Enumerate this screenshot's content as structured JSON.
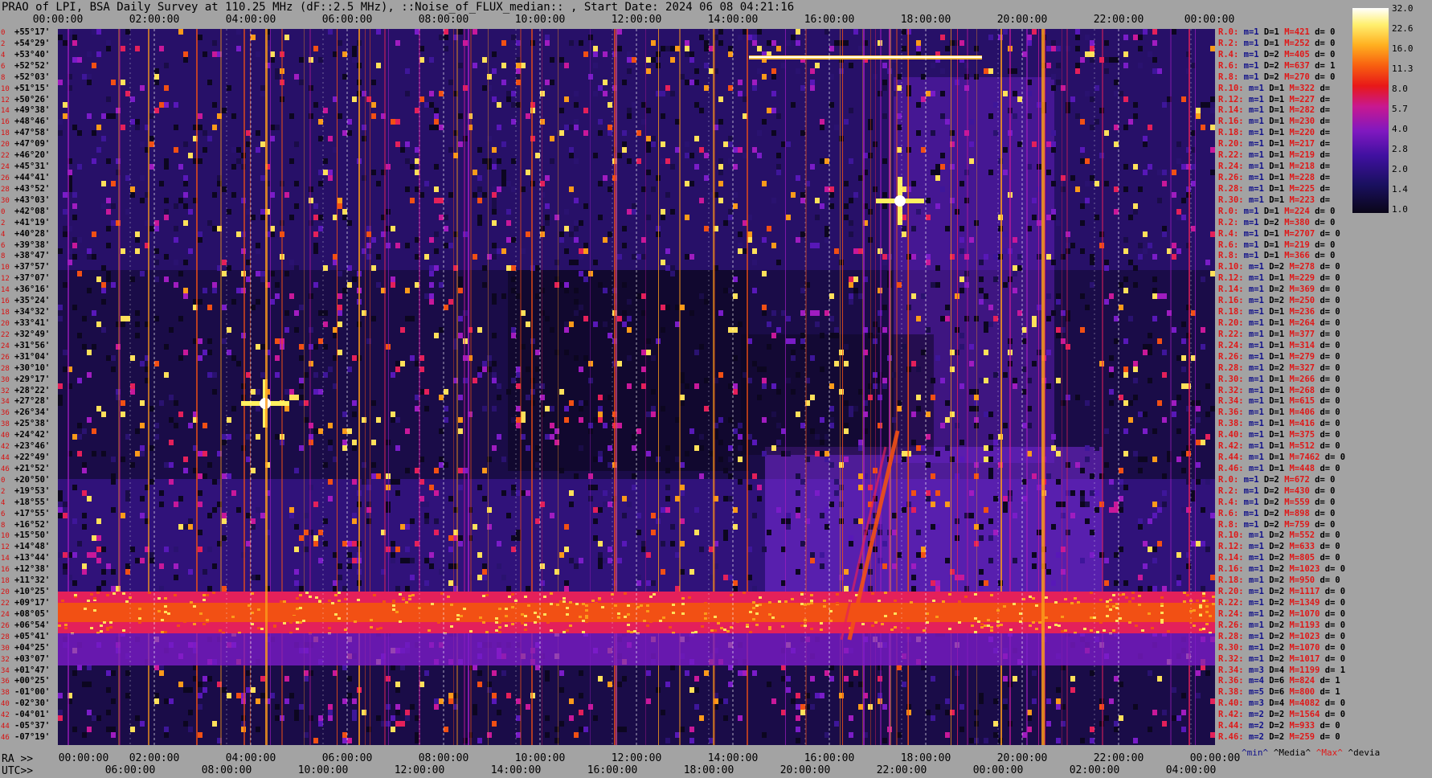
{
  "title": "PRAO of LPI, BSA Daily Survey at 110.25 MHz (dF::2.5 MHz), ::Noise_of_FLUX_median:: , Start Date: 2024 06 08 04:21:16",
  "axis_labels": {
    "ra": "RA >>",
    "utc": "UTC>>"
  },
  "footer": {
    "min": "^min^",
    "median": "^Media^",
    "max": "^Max^",
    "devia": "^devia"
  },
  "chart_data": {
    "type": "heatmap",
    "title": "PRAO of LPI, BSA Daily Survey at 110.25 MHz (dF::2.5 MHz), ::Noise_of_FLUX_median:: , Start Date: 2024 06 08 04:21:16",
    "x_top_ticks": [
      "00:00:00",
      "02:00:00",
      "04:00:00",
      "06:00:00",
      "08:00:00",
      "10:00:00",
      "12:00:00",
      "14:00:00",
      "16:00:00",
      "18:00:00",
      "20:00:00",
      "22:00:00",
      "00:00:00"
    ],
    "ra_ticks": [
      "00:00:00",
      "02:00:00",
      "04:00:00",
      "06:00:00",
      "08:00:00",
      "10:00:00",
      "12:00:00",
      "14:00:00",
      "16:00:00",
      "18:00:00",
      "20:00:00",
      "22:00:00",
      "00:00:00"
    ],
    "utc_ticks": [
      "06:00:00",
      "08:00:00",
      "10:00:00",
      "12:00:00",
      "14:00:00",
      "16:00:00",
      "18:00:00",
      "20:00:00",
      "22:00:00",
      "00:00:00",
      "02:00:00",
      "04:00:00"
    ],
    "declinations": [
      "+55°17'",
      "+54°29'",
      "+53°40'",
      "+52°52'",
      "+52°03'",
      "+51°15'",
      "+50°26'",
      "+49°38'",
      "+48°46'",
      "+47°58'",
      "+47°09'",
      "+46°20'",
      "+45°31'",
      "+44°41'",
      "+43°52'",
      "+43°03'",
      "+42°08'",
      "+41°19'",
      "+40°28'",
      "+39°38'",
      "+38°47'",
      "+37°57'",
      "+37°07'",
      "+36°16'",
      "+35°24'",
      "+34°32'",
      "+33°41'",
      "+32°49'",
      "+31°56'",
      "+31°04'",
      "+30°10'",
      "+29°17'",
      "+28°22'",
      "+27°28'",
      "+26°34'",
      "+25°38'",
      "+24°42'",
      "+23°46'",
      "+22°49'",
      "+21°52'",
      "+20°50'",
      "+19°53'",
      "+18°55'",
      "+17°55'",
      "+16°52'",
      "+15°50'",
      "+14°48'",
      "+13°44'",
      "+12°38'",
      "+11°32'",
      "+10°25'",
      "+09°17'",
      "+08°05'",
      "+06°54'",
      "+05°41'",
      "+04°25'",
      "+03°07'",
      "+01°47'",
      "+00°25'",
      "-01°00'",
      "-02°30'",
      "-04°01'",
      "-05°37'",
      "-07°19'"
    ],
    "row_indices": [
      "0",
      "2",
      "4",
      "6",
      "8",
      "10",
      "12",
      "14",
      "16",
      "18",
      "20",
      "22",
      "24",
      "26",
      "28",
      "30",
      "0",
      "2",
      "4",
      "6",
      "8",
      "10",
      "12",
      "14",
      "16",
      "18",
      "20",
      "22",
      "24",
      "26",
      "28",
      "30",
      "32",
      "34",
      "36",
      "38",
      "40",
      "42",
      "44",
      "46",
      "0",
      "2",
      "4",
      "6",
      "8",
      "10",
      "12",
      "14",
      "16",
      "18",
      "20",
      "22",
      "24",
      "26",
      "28",
      "30",
      "32",
      "34",
      "36",
      "38",
      "40",
      "42",
      "44",
      "46"
    ],
    "colorbar": {
      "values": [
        "32.0",
        "22.6",
        "16.0",
        "11.3",
        "8.0",
        "5.7",
        "4.0",
        "2.8",
        "2.0",
        "1.4",
        "1.0"
      ],
      "min": 1.0,
      "max": 32.0,
      "scale": "log"
    },
    "row_stats": [
      {
        "r": "R.0:",
        "m": "m=1",
        "d": "D=1",
        "h": "M=421",
        "v": "d= 0"
      },
      {
        "r": "R.2:",
        "m": "m=1",
        "d": "D=1",
        "h": "M=252",
        "v": "d= 0"
      },
      {
        "r": "R.4:",
        "m": "m=1",
        "d": "D=2",
        "h": "M=405",
        "v": "d= 0"
      },
      {
        "r": "R.6:",
        "m": "m=1",
        "d": "D=2",
        "h": "M=637",
        "v": "d= 1"
      },
      {
        "r": "R.8:",
        "m": "m=1",
        "d": "D=2",
        "h": "M=270",
        "v": "d= 0"
      },
      {
        "r": "R.10:",
        "m": "m=1",
        "d": "D=1",
        "h": "M=322",
        "v": "d="
      },
      {
        "r": "R.12:",
        "m": "m=1",
        "d": "D=1",
        "h": "M=227",
        "v": "d="
      },
      {
        "r": "R.14:",
        "m": "m=1",
        "d": "D=1",
        "h": "M=282",
        "v": "d="
      },
      {
        "r": "R.16:",
        "m": "m=1",
        "d": "D=1",
        "h": "M=230",
        "v": "d="
      },
      {
        "r": "R.18:",
        "m": "m=1",
        "d": "D=1",
        "h": "M=220",
        "v": "d="
      },
      {
        "r": "R.20:",
        "m": "m=1",
        "d": "D=1",
        "h": "M=217",
        "v": "d="
      },
      {
        "r": "R.22:",
        "m": "m=1",
        "d": "D=1",
        "h": "M=219",
        "v": "d="
      },
      {
        "r": "R.24:",
        "m": "m=1",
        "d": "D=1",
        "h": "M=218",
        "v": "d="
      },
      {
        "r": "R.26:",
        "m": "m=1",
        "d": "D=1",
        "h": "M=228",
        "v": "d="
      },
      {
        "r": "R.28:",
        "m": "m=1",
        "d": "D=1",
        "h": "M=225",
        "v": "d="
      },
      {
        "r": "R.30:",
        "m": "m=1",
        "d": "D=1",
        "h": "M=223",
        "v": "d="
      },
      {
        "r": "R.0:",
        "m": "m=1",
        "d": "D=1",
        "h": "M=224",
        "v": "d= 0"
      },
      {
        "r": "R.2:",
        "m": "m=1",
        "d": "D=2",
        "h": "M=380",
        "v": "d= 0"
      },
      {
        "r": "R.4:",
        "m": "m=1",
        "d": "D=1",
        "h": "M=2707",
        "v": "d= 0"
      },
      {
        "r": "R.6:",
        "m": "m=1",
        "d": "D=1",
        "h": "M=219",
        "v": "d= 0"
      },
      {
        "r": "R.8:",
        "m": "m=1",
        "d": "D=1",
        "h": "M=366",
        "v": "d= 0"
      },
      {
        "r": "R.10:",
        "m": "m=1",
        "d": "D=2",
        "h": "M=278",
        "v": "d= 0"
      },
      {
        "r": "R.12:",
        "m": "m=1",
        "d": "D=1",
        "h": "M=229",
        "v": "d= 0"
      },
      {
        "r": "R.14:",
        "m": "m=1",
        "d": "D=2",
        "h": "M=369",
        "v": "d= 0"
      },
      {
        "r": "R.16:",
        "m": "m=1",
        "d": "D=2",
        "h": "M=250",
        "v": "d= 0"
      },
      {
        "r": "R.18:",
        "m": "m=1",
        "d": "D=1",
        "h": "M=236",
        "v": "d= 0"
      },
      {
        "r": "R.20:",
        "m": "m=1",
        "d": "D=1",
        "h": "M=264",
        "v": "d= 0"
      },
      {
        "r": "R.22:",
        "m": "m=1",
        "d": "D=1",
        "h": "M=377",
        "v": "d= 0"
      },
      {
        "r": "R.24:",
        "m": "m=1",
        "d": "D=1",
        "h": "M=314",
        "v": "d= 0"
      },
      {
        "r": "R.26:",
        "m": "m=1",
        "d": "D=1",
        "h": "M=279",
        "v": "d= 0"
      },
      {
        "r": "R.28:",
        "m": "m=1",
        "d": "D=2",
        "h": "M=327",
        "v": "d= 0"
      },
      {
        "r": "R.30:",
        "m": "m=1",
        "d": "D=1",
        "h": "M=266",
        "v": "d= 0"
      },
      {
        "r": "R.32:",
        "m": "m=1",
        "d": "D=1",
        "h": "M=268",
        "v": "d= 0"
      },
      {
        "r": "R.34:",
        "m": "m=1",
        "d": "D=1",
        "h": "M=615",
        "v": "d= 0"
      },
      {
        "r": "R.36:",
        "m": "m=1",
        "d": "D=1",
        "h": "M=406",
        "v": "d= 0"
      },
      {
        "r": "R.38:",
        "m": "m=1",
        "d": "D=1",
        "h": "M=416",
        "v": "d= 0"
      },
      {
        "r": "R.40:",
        "m": "m=1",
        "d": "D=1",
        "h": "M=375",
        "v": "d= 0"
      },
      {
        "r": "R.42:",
        "m": "m=1",
        "d": "D=1",
        "h": "M=512",
        "v": "d= 0"
      },
      {
        "r": "R.44:",
        "m": "m=1",
        "d": "D=1",
        "h": "M=7462",
        "v": "d= 0"
      },
      {
        "r": "R.46:",
        "m": "m=1",
        "d": "D=1",
        "h": "M=448",
        "v": "d= 0"
      },
      {
        "r": "R.0:",
        "m": "m=1",
        "d": "D=2",
        "h": "M=672",
        "v": "d= 0"
      },
      {
        "r": "R.2:",
        "m": "m=1",
        "d": "D=2",
        "h": "M=430",
        "v": "d= 0"
      },
      {
        "r": "R.4:",
        "m": "m=1",
        "d": "D=2",
        "h": "M=559",
        "v": "d= 0"
      },
      {
        "r": "R.6:",
        "m": "m=1",
        "d": "D=2",
        "h": "M=898",
        "v": "d= 0"
      },
      {
        "r": "R.8:",
        "m": "m=1",
        "d": "D=2",
        "h": "M=759",
        "v": "d= 0"
      },
      {
        "r": "R.10:",
        "m": "m=1",
        "d": "D=2",
        "h": "M=552",
        "v": "d= 0"
      },
      {
        "r": "R.12:",
        "m": "m=1",
        "d": "D=2",
        "h": "M=633",
        "v": "d= 0"
      },
      {
        "r": "R.14:",
        "m": "m=1",
        "d": "D=2",
        "h": "M=805",
        "v": "d= 0"
      },
      {
        "r": "R.16:",
        "m": "m=1",
        "d": "D=2",
        "h": "M=1023",
        "v": "d= 0"
      },
      {
        "r": "R.18:",
        "m": "m=1",
        "d": "D=2",
        "h": "M=950",
        "v": "d= 0"
      },
      {
        "r": "R.20:",
        "m": "m=1",
        "d": "D=2",
        "h": "M=1117",
        "v": "d= 0"
      },
      {
        "r": "R.22:",
        "m": "m=1",
        "d": "D=2",
        "h": "M=1349",
        "v": "d= 0"
      },
      {
        "r": "R.24:",
        "m": "m=1",
        "d": "D=2",
        "h": "M=1070",
        "v": "d= 0"
      },
      {
        "r": "R.26:",
        "m": "m=1",
        "d": "D=2",
        "h": "M=1193",
        "v": "d= 0"
      },
      {
        "r": "R.28:",
        "m": "m=1",
        "d": "D=2",
        "h": "M=1023",
        "v": "d= 0"
      },
      {
        "r": "R.30:",
        "m": "m=1",
        "d": "D=2",
        "h": "M=1070",
        "v": "d= 0"
      },
      {
        "r": "R.32:",
        "m": "m=1",
        "d": "D=2",
        "h": "M=1017",
        "v": "d= 0"
      },
      {
        "r": "R.34:",
        "m": "m=3",
        "d": "D=4",
        "h": "M=1199",
        "v": "d= 1"
      },
      {
        "r": "R.36:",
        "m": "m=4",
        "d": "D=6",
        "h": "M=824",
        "v": "d= 1"
      },
      {
        "r": "R.38:",
        "m": "m=5",
        "d": "D=6",
        "h": "M=800",
        "v": "d= 1"
      },
      {
        "r": "R.40:",
        "m": "m=3",
        "d": "D=4",
        "h": "M=4082",
        "v": "d= 0"
      },
      {
        "r": "R.42:",
        "m": "m=2",
        "d": "D=2",
        "h": "M=1564",
        "v": "d= 0"
      },
      {
        "r": "R.44:",
        "m": "m=2",
        "d": "D=2",
        "h": "M=933",
        "v": "d= 0"
      },
      {
        "r": "R.46:",
        "m": "m=2",
        "d": "D=2",
        "h": "M=259",
        "v": "d= 0"
      }
    ]
  }
}
